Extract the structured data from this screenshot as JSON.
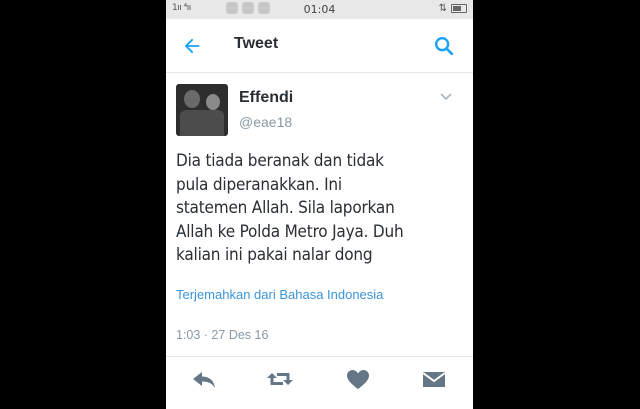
{
  "status_bar": {
    "signal": "1ıı ⁴ıı",
    "time": "01:04"
  },
  "header": {
    "title": "Tweet",
    "back_icon": "arrow-left-icon",
    "search_icon": "search-icon"
  },
  "tweet": {
    "display_name": "Effendi",
    "handle": "@eae18",
    "text": "Dia tiada beranak dan tidak\npula diperanakkan. Ini\nstatemen Allah. Sila laporkan\nAllah ke Polda Metro Jaya. Duh\nkalian ini pakai nalar dong",
    "translate_link": "Terjemahkan dari Bahasa Indonesia",
    "timestamp": "1:03 · 27 Des 16"
  },
  "actions": {
    "reply_icon": "reply-icon",
    "retweet_icon": "retweet-icon",
    "like_icon": "heart-icon",
    "dm_icon": "envelope-icon"
  },
  "colors": {
    "accent": "#1da1f2",
    "link": "#3b94d9",
    "text": "#292f33",
    "muted": "#8899a6",
    "icon_gray": "#657786"
  }
}
